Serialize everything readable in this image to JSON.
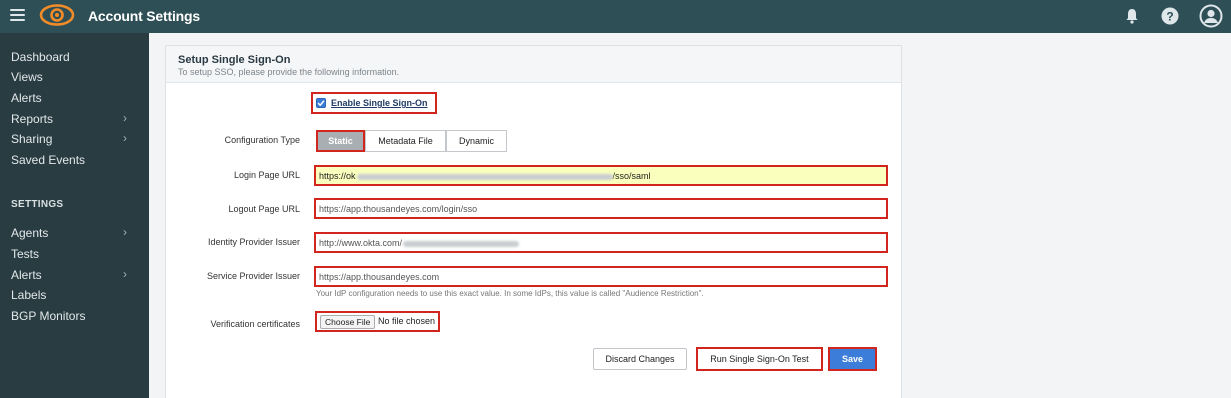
{
  "header": {
    "title": "Account Settings",
    "menu_icon": "hamburger-icon",
    "logo_icon": "eye-logo-icon",
    "notifications_icon": "bell-icon",
    "help_icon": "help-icon",
    "user_icon": "user-avatar-icon"
  },
  "sidebar": {
    "items": [
      {
        "label": "Dashboard"
      },
      {
        "label": "Views"
      },
      {
        "label": "Alerts"
      },
      {
        "label": "Reports",
        "chevron": "›"
      },
      {
        "label": "Sharing",
        "chevron": "›"
      },
      {
        "label": "Saved Events"
      }
    ],
    "settings_heading": "SETTINGS",
    "settings_items": [
      {
        "label": "Agents",
        "chevron": "›"
      },
      {
        "label": "Tests"
      },
      {
        "label": "Alerts",
        "chevron": "›"
      },
      {
        "label": "Labels"
      },
      {
        "label": "BGP Monitors"
      }
    ]
  },
  "panel": {
    "title": "Setup Single Sign-On",
    "subtitle": "To setup SSO, please provide the following information.",
    "enable_label": "Enable Single Sign-On",
    "enable_checked": true,
    "config_type_label": "Configuration Type",
    "config_types": [
      "Static",
      "Metadata File",
      "Dynamic"
    ],
    "config_selected": "Static",
    "login_label": "Login Page URL",
    "login_prefix": "https://ok",
    "login_suffix": "/sso/saml",
    "logout_label": "Logout Page URL",
    "logout_value": "https://app.thousandeyes.com/login/sso",
    "idp_label": "Identity Provider Issuer",
    "idp_prefix": "http://www.okta.com/",
    "sp_label": "Service Provider Issuer",
    "sp_value": "https://app.thousandeyes.com",
    "sp_hint": "Your IdP configuration needs to use this exact value. In some IdPs, this value is called \"Audience Restriction\".",
    "cert_label": "Verification certificates",
    "choose_file": "Choose File",
    "no_file": "No file chosen",
    "discard": "Discard Changes",
    "run_test": "Run Single Sign-On Test",
    "save": "Save"
  },
  "colors": {
    "topbar": "#2f4f57",
    "sidebar": "#293c42",
    "highlight": "#d0261e",
    "accent_orange": "#f28c28",
    "save_blue": "#3b7dd8",
    "autofill_yellow": "#faffbd"
  }
}
